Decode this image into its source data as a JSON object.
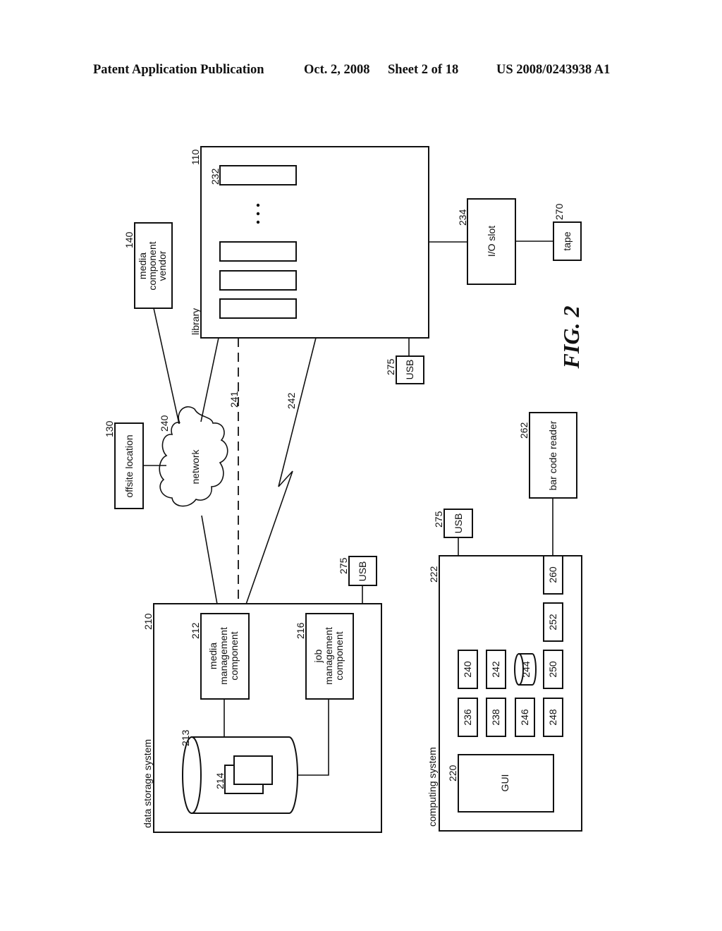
{
  "header": {
    "publication": "Patent Application Publication",
    "date": "Oct. 2, 2008",
    "sheet": "Sheet 2 of 18",
    "number": "US 2008/0243938 A1"
  },
  "figure": {
    "caption": "FIG. 2",
    "components": {
      "library": {
        "ref": "110",
        "label": "library",
        "slot_ref": "232",
        "io_slot_ref": "234",
        "io_slot_label": "I/O slot",
        "tape_ref": "270",
        "tape_label": "tape",
        "usb_ref": "275",
        "usb_label": "USB",
        "ellipsis": "•"
      },
      "vendor": {
        "ref": "140",
        "lines": [
          "media",
          "component",
          "vendor"
        ]
      },
      "offsite": {
        "ref": "130",
        "label": "offsite location"
      },
      "network": {
        "ref": "240",
        "label": "network"
      },
      "links": {
        "dashed_ref": "241",
        "wireless_ref": "242"
      },
      "data_storage": {
        "ref": "210",
        "label": "data storage system",
        "usb_ref": "275",
        "usb_label": "USB",
        "media_mgmt": {
          "ref": "212",
          "lines": [
            "media",
            "management",
            "component"
          ]
        },
        "job_mgmt": {
          "ref": "216",
          "lines": [
            "job",
            "management",
            "component"
          ]
        },
        "database_ref": "213",
        "doc_ref": "214"
      },
      "computing": {
        "ref": "222",
        "label": "computing system",
        "usb_ref": "275",
        "usb_label": "USB",
        "gui_ref": "220",
        "gui_label": "GUI",
        "modules": [
          "236",
          "240",
          "238",
          "242",
          "246",
          "244",
          "248",
          "250",
          "252",
          "260"
        ],
        "barcode_ref": "262",
        "barcode_label": "bar code reader"
      }
    }
  }
}
